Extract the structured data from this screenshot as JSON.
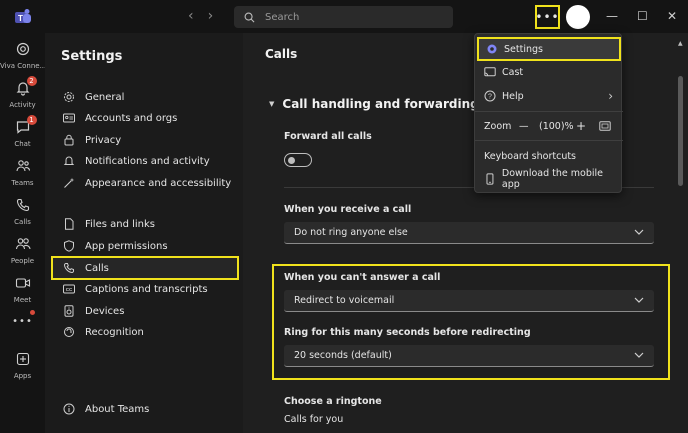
{
  "titlebar": {
    "search_placeholder": "Search",
    "more_label": "•••"
  },
  "rail": {
    "items": [
      {
        "label": "Viva Conne...",
        "icon": "viva-connections-icon"
      },
      {
        "label": "Activity",
        "icon": "bell-icon",
        "badge": "2"
      },
      {
        "label": "Chat",
        "icon": "chat-icon",
        "badge": "1"
      },
      {
        "label": "Teams",
        "icon": "teams-icon"
      },
      {
        "label": "Calls",
        "icon": "phone-icon"
      },
      {
        "label": "People",
        "icon": "people-icon"
      },
      {
        "label": "Meet",
        "icon": "video-icon"
      },
      {
        "label": "Apps",
        "icon": "apps-icon"
      }
    ],
    "more_label": "•••"
  },
  "settings": {
    "title": "Settings",
    "items": [
      {
        "label": "General",
        "icon": "gear-icon"
      },
      {
        "label": "Accounts and orgs",
        "icon": "id-card-icon"
      },
      {
        "label": "Privacy",
        "icon": "lock-icon"
      },
      {
        "label": "Notifications and activity",
        "icon": "bell-icon"
      },
      {
        "label": "Appearance and accessibility",
        "icon": "wand-icon"
      },
      {
        "label": "Files and links",
        "icon": "file-icon"
      },
      {
        "label": "App permissions",
        "icon": "shield-icon"
      },
      {
        "label": "Calls",
        "icon": "phone-icon"
      },
      {
        "label": "Captions and transcripts",
        "icon": "cc-icon"
      },
      {
        "label": "Devices",
        "icon": "speaker-icon"
      },
      {
        "label": "Recognition",
        "icon": "recognition-icon"
      },
      {
        "label": "About Teams",
        "icon": "info-icon"
      }
    ]
  },
  "main": {
    "title": "Calls",
    "section_title": "Call handling and forwarding",
    "forward_label": "Forward all calls",
    "receive_label": "When you receive a call",
    "receive_value": "Do not ring anyone else",
    "cant_answer_label": "When you can't answer a call",
    "cant_answer_value": "Redirect to voicemail",
    "ring_seconds_label": "Ring for this many seconds before redirecting",
    "ring_seconds_value": "20 seconds (default)",
    "ringtone_label": "Choose a ringtone",
    "calls_for_you_label": "Calls for you"
  },
  "menu": {
    "settings": "Settings",
    "cast": "Cast",
    "help": "Help",
    "zoom_label": "Zoom",
    "zoom_minus": "—",
    "zoom_value": "(100)%",
    "zoom_plus": "+",
    "keyboard_shortcuts": "Keyboard shortcuts",
    "download_mobile": "Download the mobile app"
  },
  "colors": {
    "highlight": "#f0e21c",
    "accent": "#7f85f5",
    "badge": "#d74a3b"
  }
}
